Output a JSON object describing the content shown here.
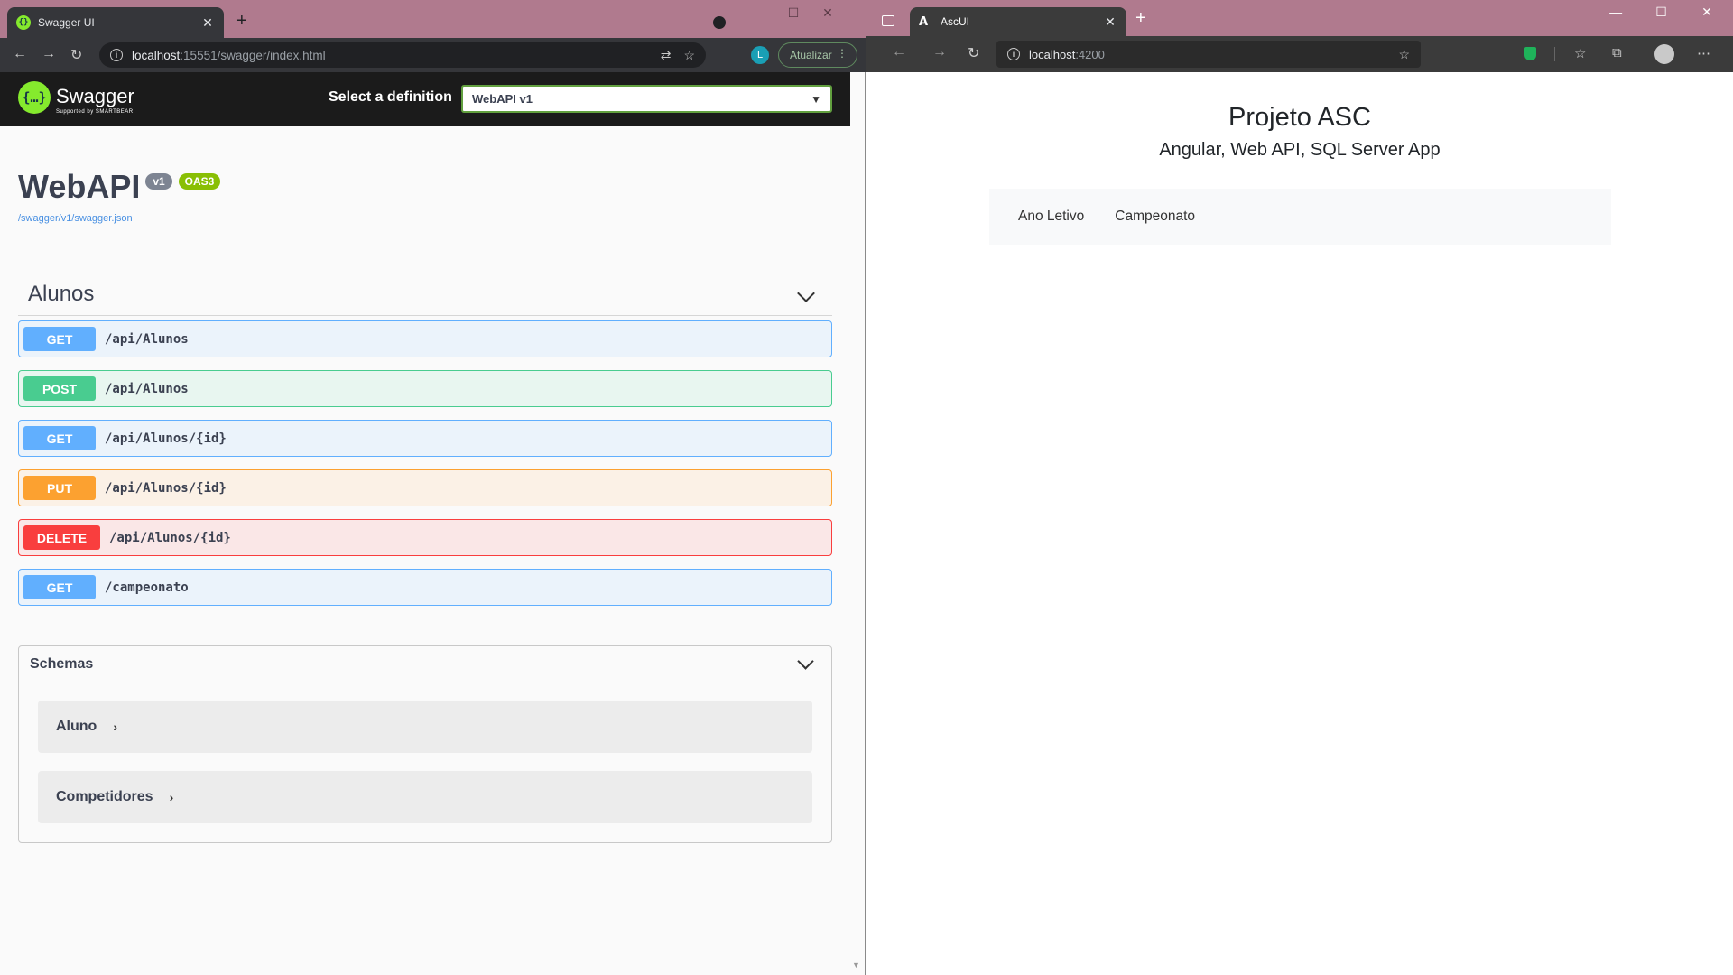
{
  "left_window": {
    "tab": {
      "favicon": "{}",
      "title": "Swagger UI",
      "close": "✕"
    },
    "new_tab": "+",
    "window_controls": [
      "—",
      "☐",
      "✕"
    ],
    "address": {
      "host": "localhost",
      "rest": ":15551/swagger/index.html"
    },
    "profile_initial": "L",
    "update_button": "Atualizar",
    "swagger": {
      "logo_symbol": "{…}",
      "brand": "Swagger",
      "brand_sub": "Supported by SMARTBEAR",
      "select_label": "Select a definition",
      "select_value": "WebAPI v1",
      "api_title": "WebAPI",
      "version_badge": "v1",
      "oas_badge": "OAS3",
      "spec_link": "/swagger/v1/swagger.json",
      "tag_name": "Alunos",
      "operations": [
        {
          "method": "GET",
          "path": "/api/Alunos"
        },
        {
          "method": "POST",
          "path": "/api/Alunos"
        },
        {
          "method": "GET",
          "path": "/api/Alunos/{id}"
        },
        {
          "method": "PUT",
          "path": "/api/Alunos/{id}"
        },
        {
          "method": "DELETE",
          "path": "/api/Alunos/{id}"
        },
        {
          "method": "GET",
          "path": "/campeonato"
        }
      ],
      "schemas_title": "Schemas",
      "schemas": [
        "Aluno",
        "Competidores"
      ]
    },
    "colors": {
      "get": "#61affe",
      "post": "#49cc90",
      "put": "#fca130",
      "delete": "#f93e3e",
      "swagger_green": "#85ea2d"
    }
  },
  "right_window": {
    "tab": {
      "title": "AscUI",
      "close": "✕"
    },
    "new_tab": "+",
    "window_controls": [
      "—",
      "☐",
      "✕"
    ],
    "address": {
      "host": "localhost",
      "rest": ":4200"
    },
    "app": {
      "title": "Projeto ASC",
      "subtitle": "Angular, Web API, SQL Server App",
      "nav": [
        "Ano Letivo",
        "Campeonato"
      ]
    }
  }
}
